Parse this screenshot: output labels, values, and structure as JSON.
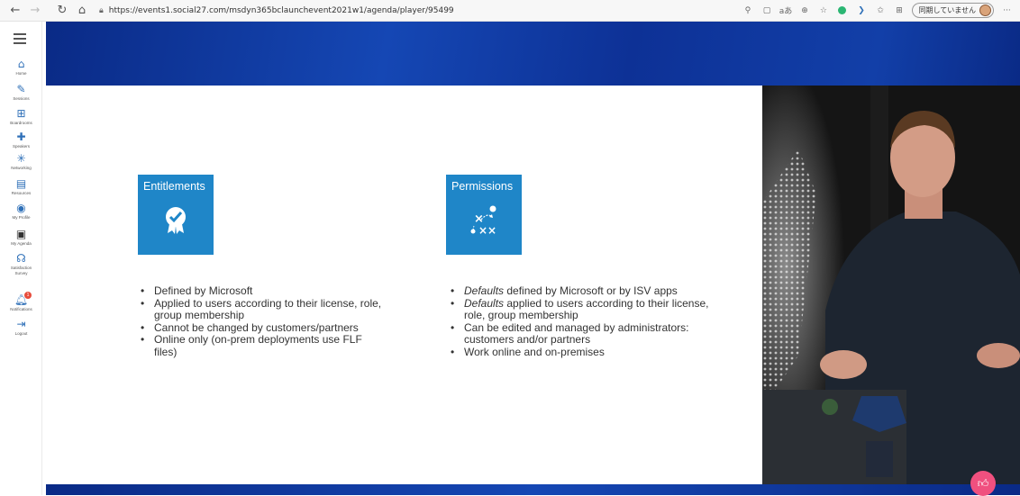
{
  "browser": {
    "url": "https://events1.social27.com/msdyn365bclaunchevent2021w1/agenda/player/95499",
    "profile_label": "同期していません",
    "icons": {
      "back": "back-arrow-icon",
      "forward": "forward-arrow-icon",
      "refresh": "refresh-icon",
      "home": "home-icon",
      "lock": "lock-icon"
    }
  },
  "sidebar": {
    "items": [
      {
        "label": "Home",
        "icon": "home-icon"
      },
      {
        "label": "Sessions",
        "icon": "pencil-icon"
      },
      {
        "label": "Boardrooms",
        "icon": "boardroom-icon"
      },
      {
        "label": "Speakers",
        "icon": "speaker-icon"
      },
      {
        "label": "Networking",
        "icon": "networking-icon"
      },
      {
        "label": "Resources",
        "icon": "resources-icon"
      },
      {
        "label": "My Profile",
        "icon": "profile-icon"
      },
      {
        "label": "My Agenda",
        "icon": "calendar-icon"
      },
      {
        "label": "Satisfaction Survey",
        "icon": "survey-icon"
      },
      {
        "label": "Notifications",
        "icon": "bell-icon",
        "badge": "1"
      },
      {
        "label": "Logout",
        "icon": "logout-icon"
      }
    ]
  },
  "slide": {
    "left": {
      "title": "Entitlements",
      "icon": "badge-check-icon",
      "bullets": [
        {
          "text": "Defined by Microsoft"
        },
        {
          "text": "Applied to users according to their license, role, group membership"
        },
        {
          "text": "Cannot be changed by customers/partners"
        },
        {
          "text": "Online only (on-prem deployments use FLF files)"
        }
      ]
    },
    "right": {
      "title": "Permissions",
      "icon": "strategy-icon",
      "bullets": [
        {
          "emph": "Defaults",
          "text": " defined by Microsoft or by ISV apps"
        },
        {
          "emph": "Defaults",
          "text": " applied to users according to their license, role, group membership"
        },
        {
          "emph": "",
          "text": "Can be edited and managed by administrators: customers and/or partners"
        },
        {
          "emph": "",
          "text": "Work online and on-premises"
        }
      ]
    }
  },
  "colors": {
    "tile": "#1f86c8",
    "nav_accent": "#2f70b8",
    "band": "#0b2c8a",
    "like": "#f0507f"
  }
}
